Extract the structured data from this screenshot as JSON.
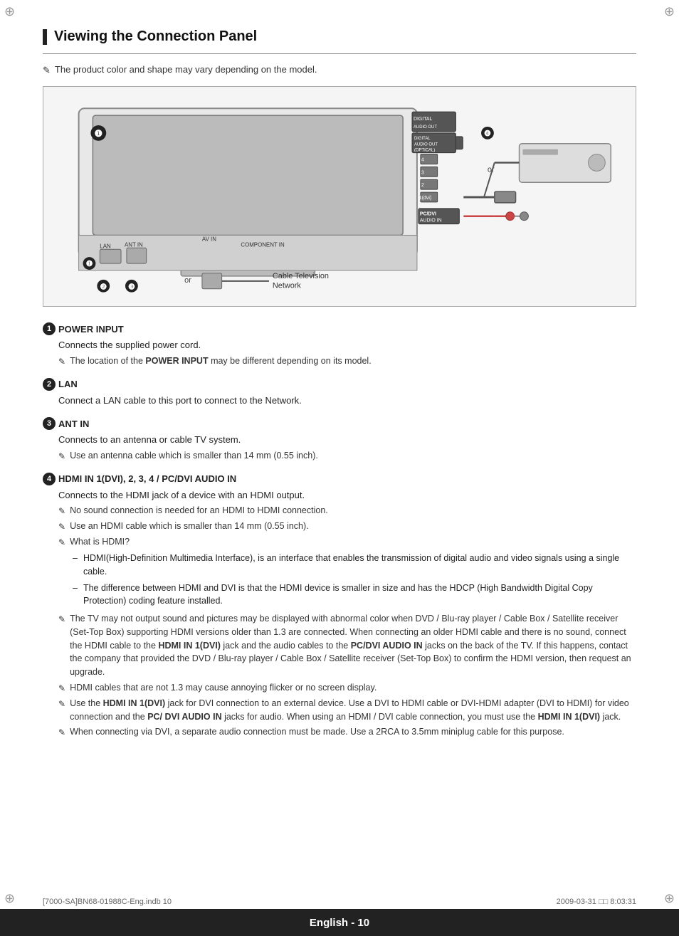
{
  "page": {
    "title": "Viewing the Connection Panel",
    "note_top": "The product color and shape may vary depending on the model.",
    "section_items": [
      {
        "num": "1",
        "title": "POWER INPUT",
        "body": "Connects the supplied power cord.",
        "notes": [
          "The location of the POWER INPUT may be different depending on its model."
        ]
      },
      {
        "num": "2",
        "title": "LAN",
        "body": "Connect a LAN cable to this port to connect to the Network.",
        "notes": []
      },
      {
        "num": "3",
        "title": "ANT IN",
        "body": "Connects to an antenna or cable TV system.",
        "notes": [
          "Use an antenna cable which is smaller than 14 mm (0.55 inch)."
        ]
      },
      {
        "num": "4",
        "title": "HDMI IN 1(DVI), 2, 3, 4 / PC/DVI AUDIO IN",
        "body": "Connects to the HDMI jack of a device with an HDMI output.",
        "notes": [
          "No sound connection is needed for an HDMI to HDMI connection.",
          "Use an HDMI cable which is smaller than 14 mm (0.55 inch).",
          "What is HDMI?"
        ],
        "dash_items": [
          "HDMI(High-Definition Multimedia Interface), is an interface that enables the transmission of digital audio and video signals using a single cable.",
          "The difference between HDMI and DVI is that the HDMI device is smaller in size and has the HDCP (High Bandwidth Digital Copy Protection) coding feature installed."
        ],
        "extra_notes": [
          "The TV may not output sound and pictures may be displayed with abnormal color when DVD / Blu-ray player / Cable Box / Satellite receiver (Set-Top Box) supporting HDMI versions older than 1.3 are connected. When connecting an older HDMI cable and there is no sound, connect the HDMI cable to the HDMI IN 1(DVI) jack and the audio cables to the PC/DVI AUDIO IN jacks on the back of the TV. If this happens, contact the company that provided the DVD / Blu-ray player / Cable Box / Satellite receiver (Set-Top Box) to confirm the HDMI version, then request an upgrade.",
          "HDMI cables that are not 1.3 may cause annoying flicker or no screen display.",
          "Use the HDMI IN 1(DVI) jack for DVI connection to an external device. Use a DVI to HDMI cable or DVI-HDMI adapter (DVI to HDMI) for video connection and the PC/ DVI AUDIO IN jacks for audio. When using an HDMI / DVI cable connection, you must use the HDMI IN 1(DVI) jack.",
          "When connecting via DVI, a separate audio connection must be made. Use a 2RCA to 3.5mm miniplug cable for this purpose."
        ]
      }
    ],
    "footer": {
      "page_text": "English - 10",
      "left_meta": "[7000-SA]BN68-01988C-Eng.indb   10",
      "right_meta": "2009-03-31   □□ 8:03:31"
    }
  }
}
